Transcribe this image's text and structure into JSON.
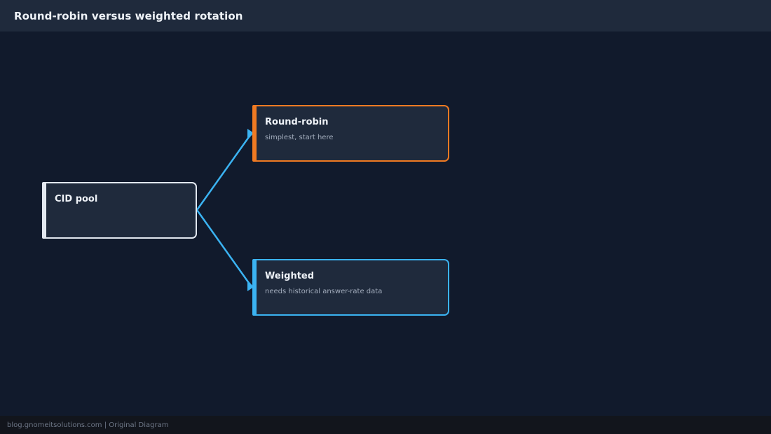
{
  "header": {
    "title": "Round-robin versus weighted rotation"
  },
  "diagram": {
    "nodes": [
      {
        "id": "cid-pool",
        "title": "CID pool",
        "subtitle": ""
      },
      {
        "id": "round-robin",
        "title": "Round-robin",
        "subtitle": "simplest, start here"
      },
      {
        "id": "weighted",
        "title": "Weighted",
        "subtitle": "needs historical answer-rate data"
      }
    ],
    "edges": [
      {
        "from": "cid-pool",
        "to": "round-robin"
      },
      {
        "from": "cid-pool",
        "to": "weighted"
      }
    ],
    "colors": {
      "background": "#111a2c",
      "header": "#1f2a3c",
      "node_fill": "#1f2a3c",
      "cid_pool_border": "#e2e8f0",
      "round_robin_border": "#f07a22",
      "weighted_border": "#3bb3f2",
      "edge": "#3bb3f2"
    }
  },
  "footer": {
    "credit": "blog.gnomeitsolutions.com | Original Diagram"
  }
}
